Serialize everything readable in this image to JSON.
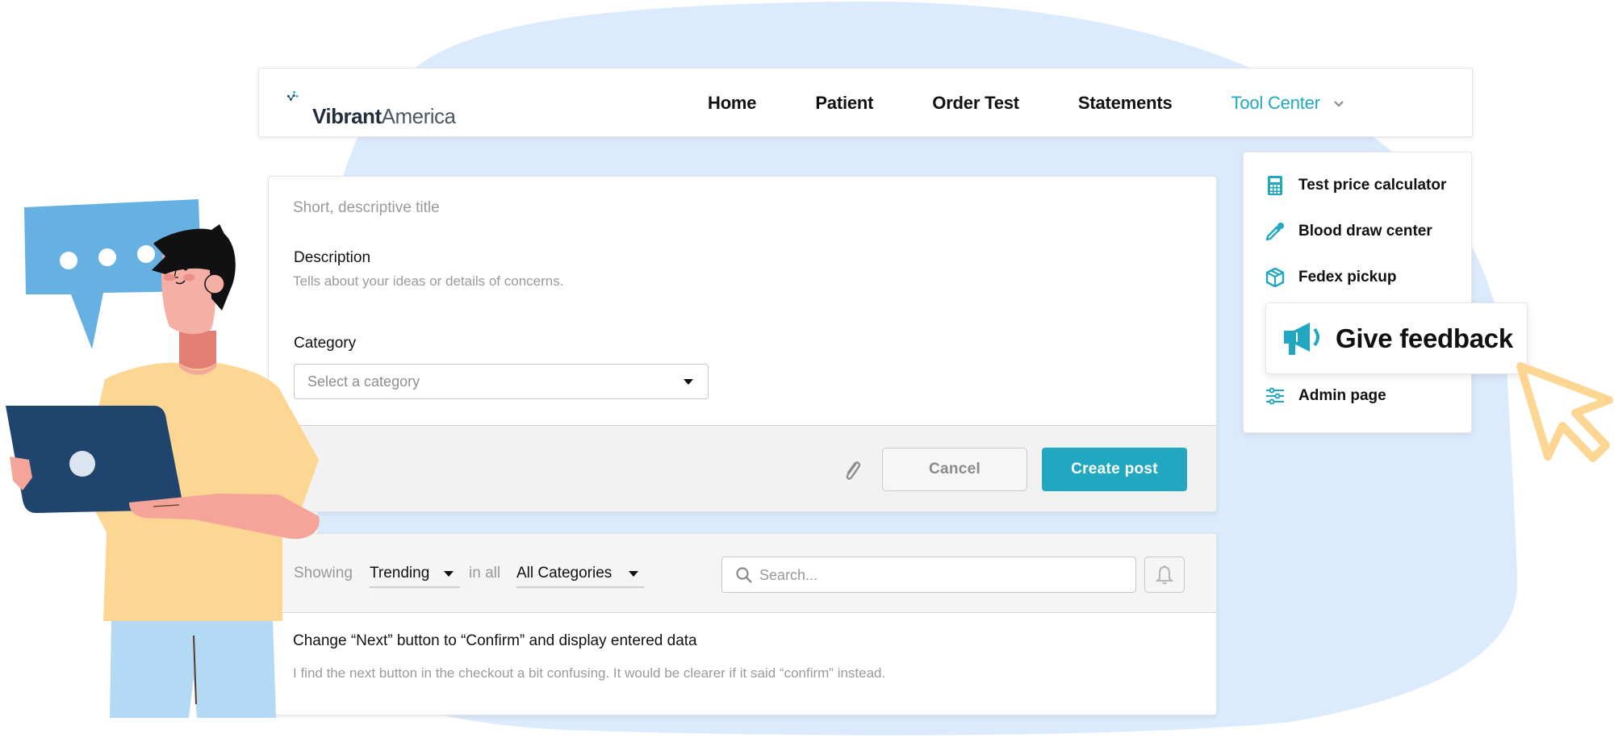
{
  "brand": {
    "name_bold": "Vibrant",
    "name_light": "America",
    "colors": {
      "accent": "#22a7c1",
      "logo_dark": "#1f4d7a",
      "logo_teal": "#2bbfcf",
      "background_blob": "#dceafd",
      "cursor_art": "#fdd694"
    }
  },
  "nav": {
    "items": [
      {
        "label": "Home"
      },
      {
        "label": "Patient"
      },
      {
        "label": "Order Test"
      },
      {
        "label": "Statements"
      },
      {
        "label": "Tool Center",
        "active": true,
        "icon": "chevron-down-icon"
      }
    ]
  },
  "tool_menu": {
    "items": [
      {
        "label": "Test price calculator",
        "icon": "calculator-icon"
      },
      {
        "label": "Blood draw center",
        "icon": "dropper-icon"
      },
      {
        "label": "Fedex pickup",
        "icon": "box-icon"
      },
      {
        "label": "Give feedback",
        "icon": "megaphone-icon",
        "highlighted": true
      },
      {
        "label": "Admin page",
        "icon": "sliders-icon"
      }
    ]
  },
  "post_form": {
    "title_placeholder": "Short, descriptive title",
    "title_value": "",
    "description_label": "Description",
    "description_placeholder": "Tells about your ideas or details of concerns.",
    "description_value": "",
    "category_label": "Category",
    "category_placeholder": "Select a category",
    "attach_icon": "paperclip-icon",
    "cancel_label": "Cancel",
    "create_label": "Create post"
  },
  "feed": {
    "showing_label": "Showing",
    "sort_value": "Trending",
    "in_all_label": "in all",
    "category_value": "All Categories",
    "search_placeholder": "Search...",
    "search_value": "",
    "bell_icon": "bell-icon",
    "posts": [
      {
        "title": "Change “Next” button to “Confirm” and display entered data",
        "body": "I find the next button in the checkout a bit confusing. It would be clearer if it said “confirm” instead."
      }
    ]
  }
}
